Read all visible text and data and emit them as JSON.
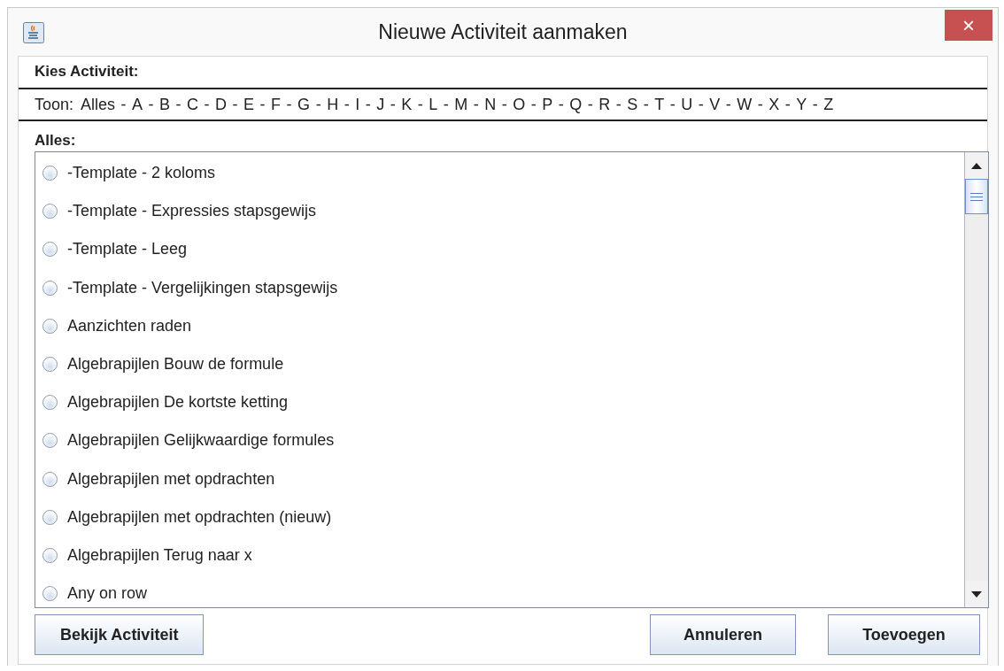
{
  "window": {
    "title": "Nieuwe Activiteit aanmaken",
    "close": "×"
  },
  "header": "Kies Activiteit:",
  "filter": {
    "label": "Toon:",
    "separator": "-",
    "options": [
      "Alles",
      "A",
      "B",
      "C",
      "D",
      "E",
      "F",
      "G",
      "H",
      "I",
      "J",
      "K",
      "L",
      "M",
      "N",
      "O",
      "P",
      "Q",
      "R",
      "S",
      "T",
      "U",
      "V",
      "W",
      "X",
      "Y",
      "Z"
    ]
  },
  "list": {
    "heading": "Alles:",
    "items": [
      {
        "label": "-Template - 2 koloms",
        "selected": false
      },
      {
        "label": "-Template - Expressies stapsgewijs",
        "selected": false
      },
      {
        "label": "-Template - Leeg",
        "selected": false
      },
      {
        "label": "-Template - Vergelijkingen stapsgewijs",
        "selected": false
      },
      {
        "label": "Aanzichten raden",
        "selected": false
      },
      {
        "label": "Algebrapijlen Bouw de formule",
        "selected": false
      },
      {
        "label": "Algebrapijlen De kortste ketting",
        "selected": false
      },
      {
        "label": "Algebrapijlen Gelijkwaardige formules",
        "selected": false
      },
      {
        "label": "Algebrapijlen met opdrachten",
        "selected": false
      },
      {
        "label": "Algebrapijlen met opdrachten (nieuw)",
        "selected": false
      },
      {
        "label": "Algebrapijlen Terug naar x",
        "selected": false
      },
      {
        "label": "Any on row",
        "selected": false
      }
    ]
  },
  "buttons": {
    "left": "Bekijk Activiteit",
    "right": [
      "Annuleren",
      "Toevoegen"
    ]
  }
}
